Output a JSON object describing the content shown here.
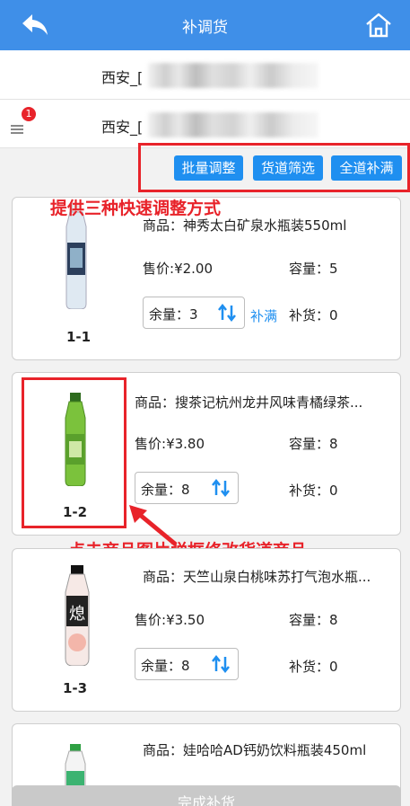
{
  "header": {
    "title": "补调货"
  },
  "rows": [
    {
      "text": "西安_["
    },
    {
      "text": "西安_[",
      "badge": "1"
    }
  ],
  "toolbar": {
    "batch_adjust": "批量调整",
    "slot_filter": "货道筛选",
    "fill_all": "全道补满"
  },
  "annotations": {
    "toolbar_note": "提供三种快速调整方式",
    "image_note": "点击商品图片弹框修改货道商品"
  },
  "labels": {
    "product": "商品：",
    "price": "售价:",
    "capacity": "容量：",
    "stock": "余量：",
    "restock": "补货：",
    "fill": "补满"
  },
  "items": [
    {
      "slot": "1-1",
      "product": "神秀太白矿泉水瓶装550ml",
      "price": "¥2.00",
      "capacity": "5",
      "stock": "3",
      "restock": "0"
    },
    {
      "slot": "1-2",
      "product": "搜茶记杭州龙井风味青橘绿茶...",
      "price": "¥3.80",
      "capacity": "8",
      "stock": "8",
      "restock": "0"
    },
    {
      "slot": "1-3",
      "product": "天竺山泉白桃味苏打气泡水瓶...",
      "price": "¥3.50",
      "capacity": "8",
      "stock": "8",
      "restock": "0"
    },
    {
      "slot": "",
      "product": "娃哈哈AD钙奶饮料瓶装450ml"
    }
  ],
  "footer": {
    "button": "完成补货"
  },
  "colors": {
    "header": "#3f8fe8",
    "accent": "#1f8ff0",
    "highlight": "#e8232a"
  }
}
